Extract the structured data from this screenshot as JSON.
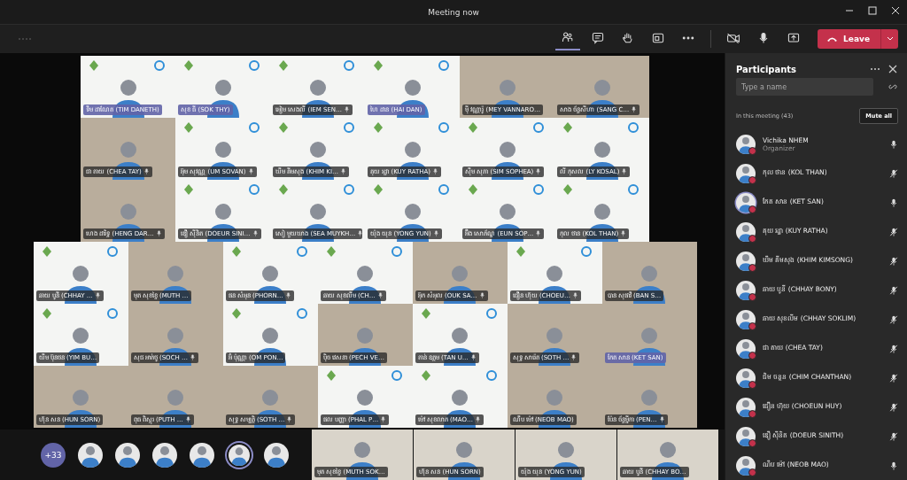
{
  "window": {
    "title": "Meeting now"
  },
  "toolbar": {
    "buttons": [
      {
        "kind": "participants",
        "selected": true
      },
      {
        "kind": "chat",
        "selected": false
      },
      {
        "kind": "hand",
        "selected": false
      },
      {
        "kind": "rooms",
        "selected": false
      },
      {
        "kind": "more",
        "selected": false
      },
      {
        "kind": "camera-off",
        "selected": false
      },
      {
        "kind": "mic",
        "selected": false
      },
      {
        "kind": "share",
        "selected": false
      }
    ],
    "leave": "Leave"
  },
  "video_grid": {
    "rows": [
      [
        {
          "name": "ទឹម ដាណែត (TIM DANETH)",
          "kind": "banner",
          "mic_icon": false,
          "highlighted": true
        },
        {
          "name": "សុខ ធី (SOK THY)",
          "kind": "banner",
          "mic_icon": false,
          "highlighted": true
        },
        {
          "name": "អៀម សេងលី (IEM SEN…",
          "kind": "banner",
          "mic_icon": true,
          "highlighted": false
        },
        {
          "name": "ហៃ ដាន (HAI DAN)",
          "kind": "banner",
          "mic_icon": false,
          "highlighted": true
        },
        {
          "name": "ម៉ី វណ្ណារ៉ូ (MEY VANNARO…",
          "kind": "room",
          "mic_icon": false,
          "highlighted": false
        },
        {
          "name": "សាង ច័ន្ទសីហា (SANG C…",
          "kind": "room",
          "mic_icon": true,
          "highlighted": false
        }
      ],
      [
        {
          "name": "ជា តាយ (CHEA TAY)",
          "kind": "room",
          "mic_icon": true,
          "highlighted": false
        },
        {
          "name": "អ៊ុម សុវណ្ណ (UM SOVAN)",
          "kind": "banner",
          "mic_icon": true,
          "highlighted": false
        },
        {
          "name": "ឃឹម គីមសុង (KHIM KI…",
          "kind": "banner",
          "mic_icon": true,
          "highlighted": false
        },
        {
          "name": "គុយ រដ្ឋា (KUY RATHA)",
          "kind": "banner",
          "mic_icon": true,
          "highlighted": false
        },
        {
          "name": "ស៊ឹម សុភា (SIM SOPHEA)",
          "kind": "banner",
          "mic_icon": true,
          "highlighted": false
        },
        {
          "name": "លី កុសល (LY KOSAL)",
          "kind": "banner",
          "mic_icon": true,
          "highlighted": false
        }
      ],
      [
        {
          "name": "ហេង ដារិទ្ធ (HENG DAR…",
          "kind": "room",
          "mic_icon": true,
          "highlighted": false
        },
        {
          "name": "ឌឿ ស៊ីនិត (DOEUR SINI…",
          "kind": "banner",
          "mic_icon": true,
          "highlighted": false
        },
        {
          "name": "សៀ មួយឃាង (SEA MUYKH…",
          "kind": "banner",
          "mic_icon": true,
          "highlighted": false
        },
        {
          "name": "យ៉ុង យុន (YONG YUN)",
          "kind": "banner",
          "mic_icon": true,
          "highlighted": false
        },
        {
          "name": "អ៊ឹង សោភ័ណ្ឌ (EUN SOP…",
          "kind": "banner",
          "mic_icon": true,
          "highlighted": false
        },
        {
          "name": "កុល ថាន (KOL THAN)",
          "kind": "banner",
          "mic_icon": true,
          "highlighted": false
        }
      ],
      [
        {
          "name": "ឆាយ បូនី (CHHAY …",
          "kind": "banner",
          "mic_icon": true,
          "highlighted": false
        },
        {
          "name": "មុត សុខខ្ចៃ (MUTH …",
          "kind": "room",
          "mic_icon": false,
          "highlighted": false
        },
        {
          "name": "ផន សំអុន (PHORN…",
          "kind": "banner",
          "mic_icon": true,
          "highlighted": false
        },
        {
          "name": "ឆាយ សុខលីម (CH…",
          "kind": "banner",
          "mic_icon": true,
          "highlighted": false
        },
        {
          "name": "អ៊ុក សំអុល (OUK SA…",
          "kind": "room",
          "mic_icon": true,
          "highlighted": false
        },
        {
          "name": "ជឿន ហ៊ុយ (CHOEU…",
          "kind": "banner",
          "mic_icon": true,
          "highlighted": false
        },
        {
          "name": "បាន សុផាវី (BAN S…",
          "kind": "room",
          "mic_icon": false,
          "highlighted": false
        }
      ],
      [
        {
          "name": "យឹម ប៊ុនថន (YIM BU…",
          "kind": "banner",
          "mic_icon": false,
          "highlighted": false
        },
        {
          "name": "សុជ អាត់ថូ (SOCH …",
          "kind": "room",
          "mic_icon": true,
          "highlighted": false
        },
        {
          "name": "អ៊ំ ប៉ុណ្ណា (OM PON…",
          "kind": "banner",
          "mic_icon": false,
          "highlighted": false
        },
        {
          "name": "ប៉ិច វេសនា (PECH VE…",
          "kind": "room",
          "mic_icon": false,
          "highlighted": false
        },
        {
          "name": "តាន់ ឧត្តម (TAN U…",
          "kind": "banner",
          "mic_icon": true,
          "highlighted": false
        },
        {
          "name": "សុទ្ធ សារ៉េត (SOTH …",
          "kind": "room",
          "mic_icon": true,
          "highlighted": false
        },
        {
          "name": "កែត សាន (KET SAN)",
          "kind": "room",
          "mic_icon": false,
          "highlighted": true
        }
      ],
      [
        {
          "name": "ហ៊ុន សន (HUN SORN)",
          "kind": "room",
          "mic_icon": false,
          "highlighted": false
        },
        {
          "name": "ពុធ ពិស្ដុរ (PUTH …",
          "kind": "room",
          "mic_icon": true,
          "highlighted": false
        },
        {
          "name": "សុទ្ធ សម្បត្តិ (SOTH …",
          "kind": "room",
          "mic_icon": true,
          "highlighted": false
        },
        {
          "name": "ផល បញ្ញា (PHAL P…",
          "kind": "banner",
          "mic_icon": true,
          "highlighted": false
        },
        {
          "name": "ម៉ៅ សុខលាភ (MAO…",
          "kind": "banner",
          "mic_icon": true,
          "highlighted": false
        },
        {
          "name": "ណឹប ម៉ៅ (NEOB MAO)",
          "kind": "room",
          "mic_icon": false,
          "highlighted": false
        },
        {
          "name": "ប៉ែន ច័ន្ទម្នីកា (PEN…",
          "kind": "room",
          "mic_icon": true,
          "highlighted": false
        }
      ]
    ]
  },
  "strip": {
    "overflow": "+33",
    "avatars": [
      {
        "selected": false
      },
      {
        "selected": false
      },
      {
        "selected": false
      },
      {
        "selected": false
      },
      {
        "selected": true
      },
      {
        "selected": false
      }
    ],
    "tiles": [
      {
        "name": "មុត សុខខ្ចៃ (MUTH SOK…"
      },
      {
        "name": "ហ៊ុន សន (HUN SORN)"
      },
      {
        "name": "យ៉ុង យុន (YONG YUN)"
      },
      {
        "name": "ឆាយ បូនី (CHHAY BO…"
      }
    ]
  },
  "participants": {
    "title": "Participants",
    "search": {
      "placeholder": "Type a name"
    },
    "section": "In this meeting (43)",
    "mute_all": "Mute all",
    "people": [
      {
        "name": "Vichika NHEM",
        "role": "Organizer",
        "muted": false,
        "speaking": false
      },
      {
        "name": "កុល ថាន (KOL THAN)",
        "muted": true,
        "speaking": false
      },
      {
        "name": "កែត សាន (KET SAN)",
        "muted": false,
        "speaking": true
      },
      {
        "name": "គុយ រដ្ឋា (KUY RATHA)",
        "muted": true,
        "speaking": false
      },
      {
        "name": "ឃឹម គីមសុង (KHIM KIMSONG)",
        "muted": true,
        "speaking": false
      },
      {
        "name": "ឆាយ បូនី (CHHAY BONY)",
        "muted": true,
        "speaking": false
      },
      {
        "name": "ឆាយ សុខលីម (CHHAY SOKLIM)",
        "muted": true,
        "speaking": false
      },
      {
        "name": "ជា តាយ (CHEA TAY)",
        "muted": true,
        "speaking": false
      },
      {
        "name": "ជិម ចន្ថន (CHIM CHANTHAN)",
        "muted": true,
        "speaking": false
      },
      {
        "name": "ជឿន ហ៊ុយ (CHOEUN HUY)",
        "muted": true,
        "speaking": false
      },
      {
        "name": "ឌឿ ស៊ីនិត (DOEUR SINITH)",
        "muted": true,
        "speaking": false
      },
      {
        "name": "ណឹប ម៉ៅ (NEOB MAO)",
        "muted": false,
        "speaking": false
      }
    ]
  }
}
